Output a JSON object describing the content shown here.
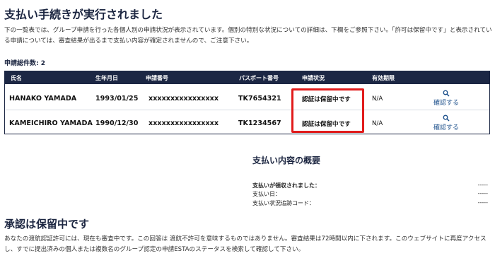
{
  "page": {
    "title": "支払い手続きが実行されました",
    "intro": "下の一覧表では、グループ申請を行った各個人別の申請状況が表示されています。個別の特別な状況についての詳細は、下欄をご参照下さい。「許可は保留中です」と表示されている申請については、審査結果が出るまで支払い内容が確定されませんので、ご注意下さい。",
    "count_label": "申請総件数: 2"
  },
  "table": {
    "headers": {
      "name": "氏名",
      "dob": "生年月日",
      "app_no": "申請番号",
      "passport": "パスポート番号",
      "status": "申請状況",
      "validity": "有効期限",
      "action": ""
    },
    "rows": [
      {
        "name": "HANAKO YAMADA",
        "dob": "1993/01/25",
        "app_no": "xxxxxxxxxxxxxxxx",
        "passport": "TK7654321",
        "status": "認証は保留中です",
        "validity": "N/A",
        "action": "確認する"
      },
      {
        "name": "KAMEICHIRO YAMADA",
        "dob": "1990/12/30",
        "app_no": "xxxxxxxxxxxxxxxx",
        "passport": "TK1234567",
        "status": "認証は保留中です",
        "validity": "N/A",
        "action": "確認する"
      }
    ]
  },
  "summary": {
    "title": "支払い内容の概要",
    "rows": [
      {
        "label": "支払いが領収されました：",
        "value": "-----"
      },
      {
        "label": "支払い日：",
        "value": "-----"
      },
      {
        "label": "支払い状況追跡コード：",
        "value": "-----"
      }
    ]
  },
  "pending": {
    "title": "承認は保留中です",
    "text": "あなたの渡航認証許可には、現在も審査中です。この回答は 渡航不許可を意味するものではありません。審査結果は72時間以内に下されます。このウェブサイトに再度アクセスし、すでに提出済みの個人または複数名のグループ認定の申請ESTAのステータスを検索して確認して下さい。"
  },
  "colors": {
    "header_bg": "#1c2744",
    "highlight": "#e11b1b",
    "link": "#1a4e8a"
  },
  "icons": {
    "check": "magnifier-icon"
  }
}
